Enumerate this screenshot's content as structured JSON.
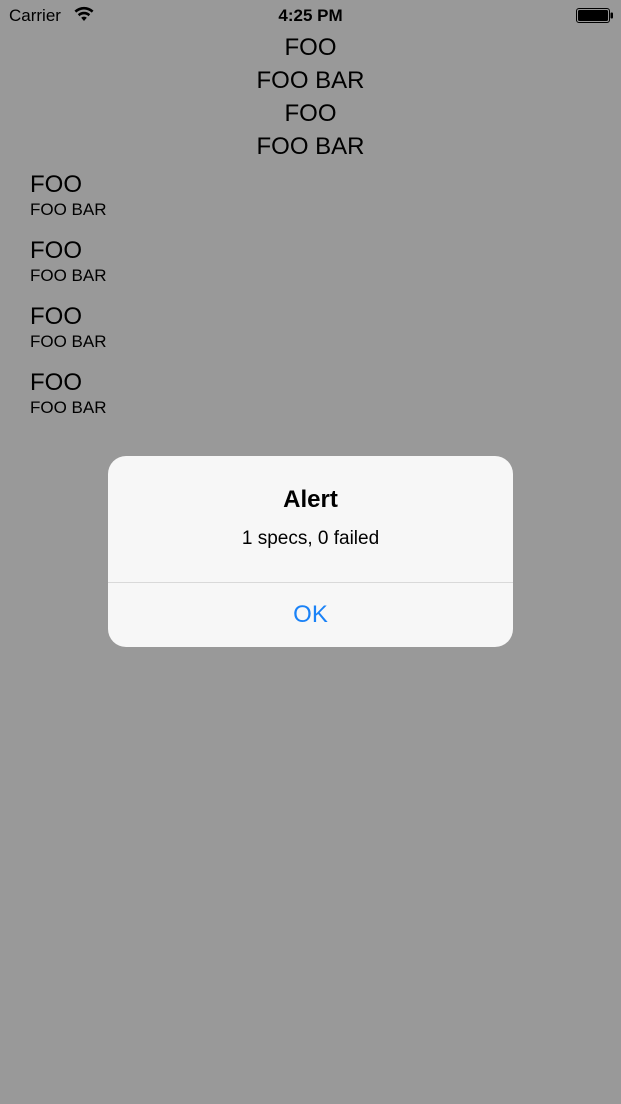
{
  "status_bar": {
    "carrier": "Carrier",
    "time": "4:25 PM"
  },
  "center_labels": [
    "FOO",
    "FOO BAR",
    "FOO",
    "FOO BAR"
  ],
  "list_items": [
    {
      "title": "FOO",
      "subtitle": "FOO BAR"
    },
    {
      "title": "FOO",
      "subtitle": "FOO BAR"
    },
    {
      "title": "FOO",
      "subtitle": "FOO BAR"
    },
    {
      "title": "FOO",
      "subtitle": "FOO BAR"
    }
  ],
  "alert": {
    "title": "Alert",
    "message": "1 specs, 0 failed",
    "ok_label": "OK"
  },
  "colors": {
    "background": "#ffffff",
    "dim_overlay": "rgba(0,0,0,0.4)",
    "alert_background": "#f7f7f7",
    "accent": "#1a82f7"
  },
  "icons": [
    "wifi-icon",
    "battery-icon"
  ]
}
